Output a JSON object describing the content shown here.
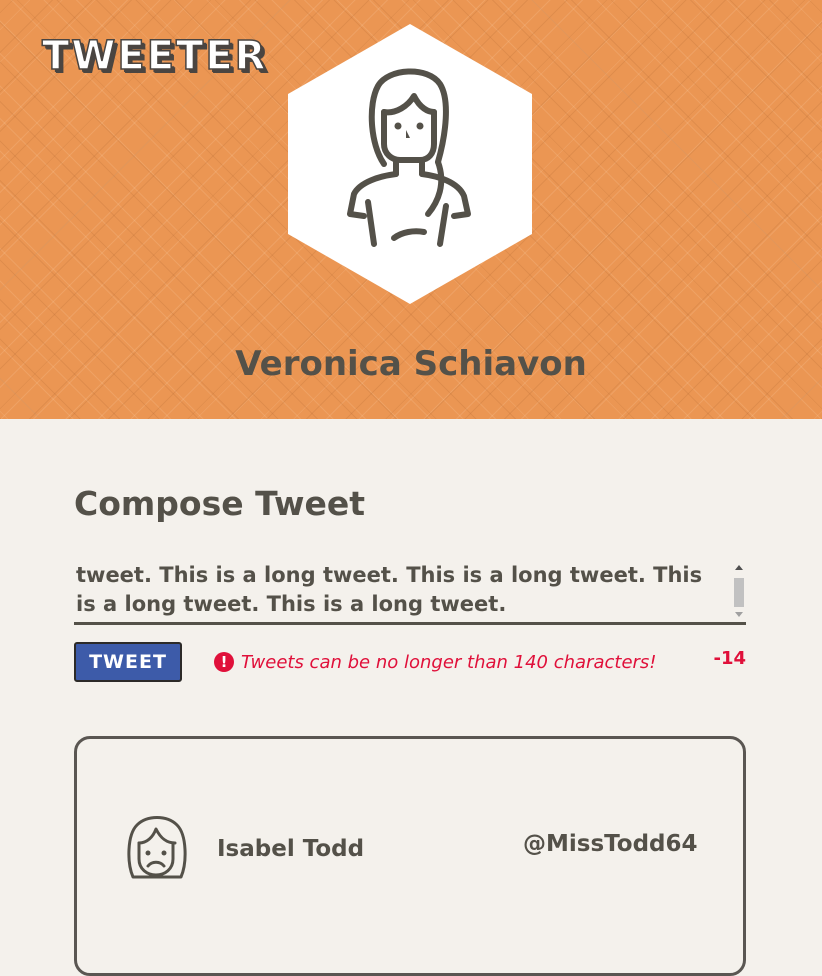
{
  "header": {
    "logo": "TWEETER",
    "profile_name": "Veronica Schiavon",
    "avatar_icon": "woman-avatar-icon"
  },
  "compose": {
    "title": "Compose Tweet",
    "text_visible": "tweet. This is a long tweet. This is a long tweet. This is a long tweet. This is a long tweet.",
    "button_label": "TWEET",
    "error_icon": "exclamation-circle-icon",
    "error_message": "Tweets can be no longer than 140 characters!",
    "counter": "-14"
  },
  "tweets": [
    {
      "name": "Isabel Todd",
      "handle": "@MissTodd64",
      "avatar_icon": "frowning-woman-avatar-icon"
    }
  ],
  "colors": {
    "header_bg": "#eb9653",
    "page_bg": "#f4f1ec",
    "text": "#545149",
    "button_bg": "#3d5ba9",
    "error": "#e0103a"
  }
}
